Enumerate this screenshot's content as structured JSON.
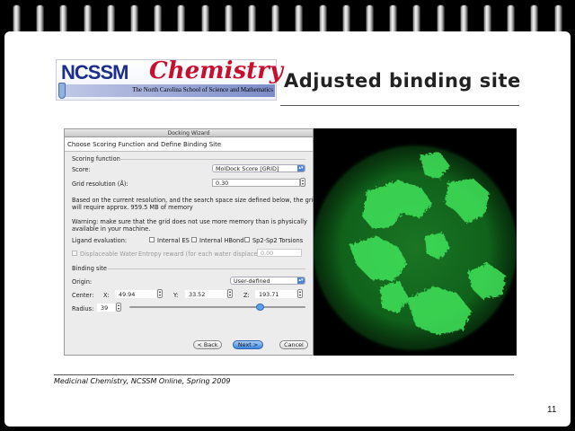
{
  "slide": {
    "title": "Adjusted binding site",
    "footer": "Medicinal Chemistry, NCSSM Online, Spring 2009",
    "page_number": "11"
  },
  "logo": {
    "brand": "NCSSM",
    "subject": "Chemistry",
    "school": "The North Carolina School of Science and Mathematics"
  },
  "dialog": {
    "window_title": "Docking Wizard",
    "header": "Choose Scoring Function and Define Binding Site",
    "scoring": {
      "group_label": "Scoring function",
      "score_label": "Score:",
      "score_value": "MolDock Score [GRID]",
      "grid_label": "Grid resolution (Å):",
      "grid_value": "0.30",
      "info_text_1": "Based on the current resolution, and the search space size defined below, the grid",
      "info_text_2": "will require approx. 959.5 MB of memory",
      "warning_1": "Warning: make sure that the grid does not use more memory than is physically",
      "warning_2": "available in your machine.",
      "ligand_label": "Ligand evaluation:",
      "option_internal_es": "Internal ES",
      "option_internal_hbond": "Internal HBond",
      "option_sp2": "Sp2-Sp2 Torsions",
      "displaceable_label": "Displaceable Water",
      "entropy_label": "Entropy reward (for each water displaced):",
      "entropy_value": "0.00"
    },
    "binding": {
      "group_label": "Binding site",
      "origin_label": "Origin:",
      "origin_value": "User-defined",
      "center_label": "Center:",
      "x_label": "X:",
      "x_value": "49.94",
      "y_label": "Y:",
      "y_value": "33.52",
      "z_label": "Z:",
      "z_value": "193.71",
      "radius_label": "Radius:",
      "radius_value": "39",
      "radius_slider_fraction": 0.74
    },
    "buttons": {
      "back": "< Back",
      "next": "Next >",
      "cancel": "Cancel"
    }
  },
  "colors": {
    "viewer_glow": "#2ecc40",
    "viewer_background": "#000000",
    "accent": "#3d86e0"
  }
}
